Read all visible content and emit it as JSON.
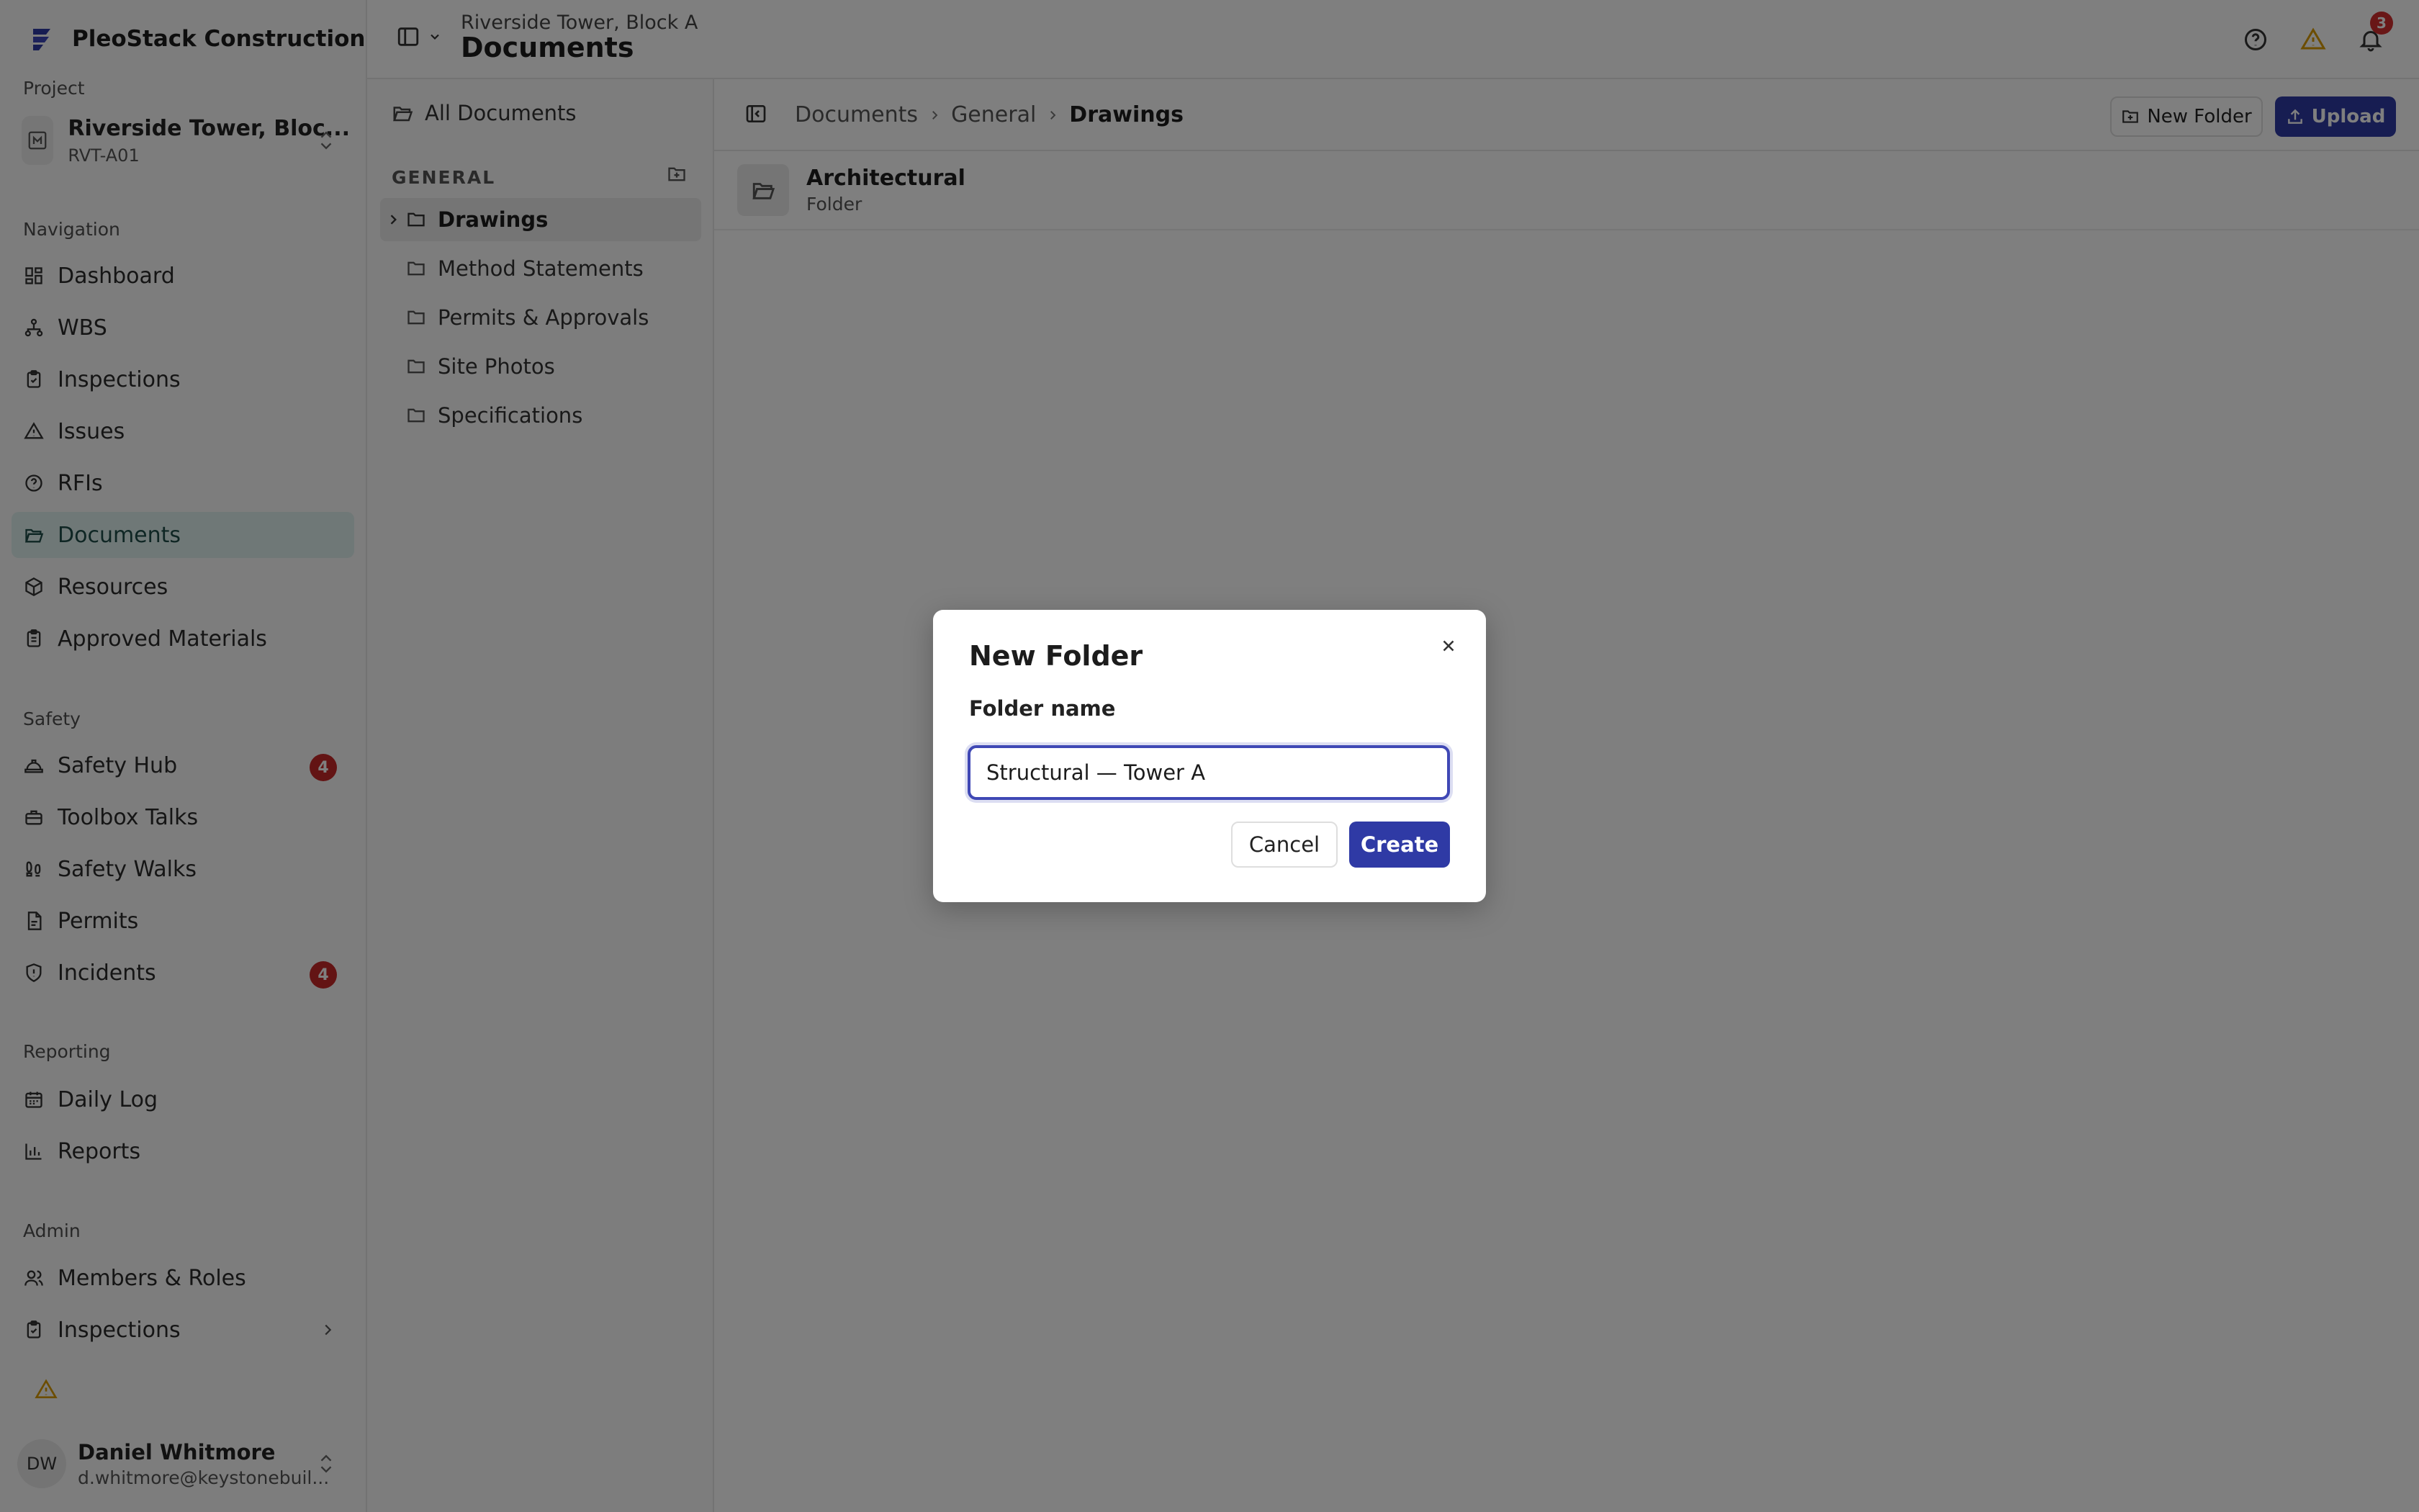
{
  "brand": {
    "name": "PleoStack Construction ..."
  },
  "project": {
    "section_label": "Project",
    "name": "Riverside Tower, Bloc...",
    "code": "RVT-A01"
  },
  "nav": {
    "label": "Navigation",
    "items": [
      {
        "label": "Dashboard",
        "icon": "dashboard-icon"
      },
      {
        "label": "WBS",
        "icon": "hierarchy-icon"
      },
      {
        "label": "Inspections",
        "icon": "clipboard-check-icon"
      },
      {
        "label": "Issues",
        "icon": "warning-icon"
      },
      {
        "label": "RFIs",
        "icon": "question-icon"
      },
      {
        "label": "Documents",
        "icon": "folder-open-icon",
        "active": true
      },
      {
        "label": "Resources",
        "icon": "box-icon"
      },
      {
        "label": "Approved Materials",
        "icon": "clipboard-list-icon"
      }
    ]
  },
  "safety": {
    "label": "Safety",
    "items": [
      {
        "label": "Safety Hub",
        "icon": "hard-hat-icon",
        "badge": "4"
      },
      {
        "label": "Toolbox Talks",
        "icon": "toolbox-icon"
      },
      {
        "label": "Safety Walks",
        "icon": "footprints-icon"
      },
      {
        "label": "Permits",
        "icon": "document-icon"
      },
      {
        "label": "Incidents",
        "icon": "shield-icon",
        "badge": "4"
      }
    ]
  },
  "reporting": {
    "label": "Reporting",
    "items": [
      {
        "label": "Daily Log",
        "icon": "calendar-icon"
      },
      {
        "label": "Reports",
        "icon": "bar-chart-icon"
      }
    ]
  },
  "admin": {
    "label": "Admin",
    "items": [
      {
        "label": "Members & Roles",
        "icon": "users-icon"
      },
      {
        "label": "Inspections",
        "icon": "clipboard-check-icon"
      }
    ]
  },
  "user": {
    "initials": "DW",
    "name": "Daniel Whitmore",
    "email": "d.whitmore@keystonebuil..."
  },
  "header": {
    "breadcrumb": "Riverside Tower, Block A",
    "title": "Documents",
    "notification_count": "3"
  },
  "tree": {
    "all_label": "All Documents",
    "section_heading": "GENERAL",
    "folders": [
      {
        "label": "Drawings",
        "selected": true,
        "expandable": true
      },
      {
        "label": "Method Statements"
      },
      {
        "label": "Permits & Approvals"
      },
      {
        "label": "Site Photos"
      },
      {
        "label": "Specifications"
      }
    ]
  },
  "toolbar": {
    "breadcrumb": [
      "Documents",
      "General",
      "Drawings"
    ],
    "new_folder_label": "New Folder",
    "upload_label": "Upload"
  },
  "files": [
    {
      "name": "Architectural",
      "type": "Folder"
    }
  ],
  "dialog": {
    "title": "New Folder",
    "field_label": "Folder name",
    "field_value": "Structural — Tower A",
    "cancel_label": "Cancel",
    "create_label": "Create"
  },
  "colors": {
    "primary": "#2f3aa5",
    "active_nav_bg": "#dff1ee",
    "badge": "#c62828",
    "warning": "#d99a00"
  }
}
